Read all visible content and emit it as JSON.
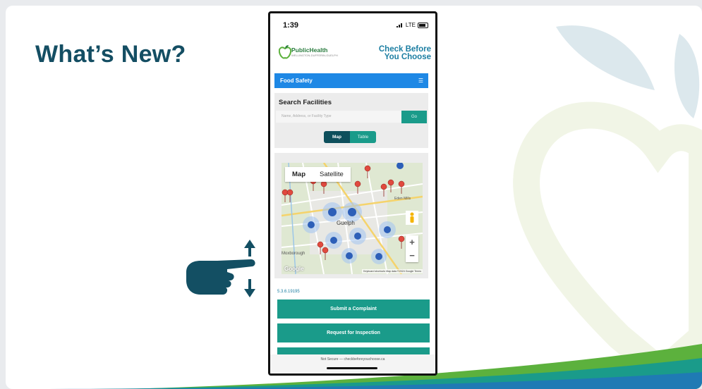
{
  "slide": {
    "title": "What’s New?"
  },
  "phone": {
    "status": {
      "time": "1:39",
      "network": "LTE"
    },
    "header": {
      "org_name": "PublicHealth",
      "org_sub": "WELLINGTON-DUFFERIN-GUELPH",
      "brand_line1": "Check Before",
      "brand_line2": "You Choose"
    },
    "nav": {
      "section": "Food Safety"
    },
    "search": {
      "title": "Search Facilities",
      "placeholder": "Name, Address, or Facility Type",
      "go_label": "Go",
      "view_map": "Map",
      "view_table": "Table"
    },
    "map": {
      "tab_map": "Map",
      "tab_satellite": "Satellite",
      "city_label": "Guelph",
      "area_label_1": "Moxborough",
      "area_label_2": "Eden Mills",
      "google_label": "Google",
      "attribution": "Keyboard shortcuts   Map data ©2024 Google   Terms",
      "zoom_in": "+",
      "zoom_out": "−"
    },
    "version": "5.3.6.19195",
    "buttons": {
      "complaint": "Submit a Complaint",
      "inspection": "Request for Inspection"
    },
    "url_bar": "Not Secure — checkbeforeyouchoose.ca"
  },
  "colors": {
    "title": "#144e63",
    "teal": "#1a9b8a",
    "nav_blue": "#1e88e5",
    "brand_blue": "#1c7ea2",
    "green_stripe": "#5cb13d"
  },
  "icons": [
    "hand-pointing-icon",
    "arrow-up-icon",
    "arrow-down-icon",
    "menu-icon",
    "map-pin-icon",
    "pegman-icon",
    "apple-logo-icon"
  ]
}
